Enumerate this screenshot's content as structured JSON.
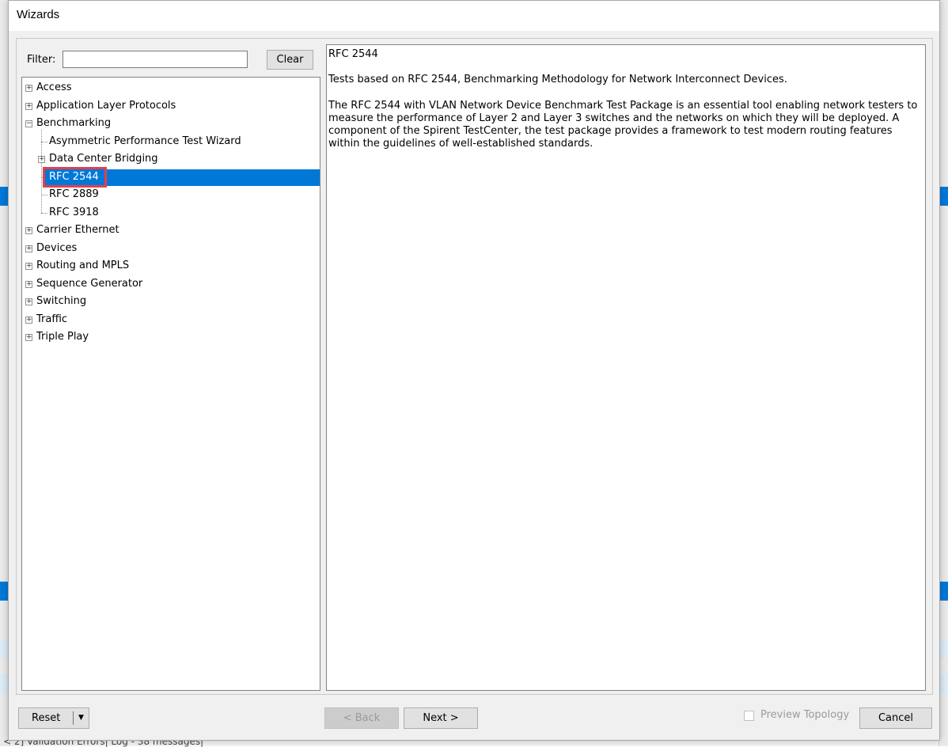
{
  "dialog": {
    "title": "Wizards"
  },
  "filter": {
    "label": "Filter:",
    "value": "",
    "clear_label": "Clear"
  },
  "tree": {
    "items": [
      {
        "label": "Access"
      },
      {
        "label": "Application Layer Protocols"
      },
      {
        "label": "Benchmarking"
      },
      {
        "label": "Asymmetric Performance Test Wizard"
      },
      {
        "label": "Data Center Bridging"
      },
      {
        "label": "RFC 2544"
      },
      {
        "label": "RFC 2889"
      },
      {
        "label": "RFC 3918"
      },
      {
        "label": "Carrier Ethernet"
      },
      {
        "label": "Devices"
      },
      {
        "label": "Routing and MPLS"
      },
      {
        "label": "Sequence Generator"
      },
      {
        "label": "Switching"
      },
      {
        "label": "Traffic"
      },
      {
        "label": "Triple Play"
      }
    ],
    "selected": "RFC 2544"
  },
  "description": {
    "title": "RFC 2544",
    "paragraph1": "Tests based on RFC 2544, Benchmarking Methodology for Network Interconnect Devices.",
    "paragraph2": "The RFC 2544 with VLAN Network Device Benchmark Test Package is an essential tool enabling network testers to measure the performance of Layer 2 and Layer 3 switches and the networks on which they will be deployed. A component of the Spirent TestCenter, the test package provides a framework to test modern routing features within the guidelines of well-established standards."
  },
  "buttons": {
    "reset": "Reset",
    "back": "< Back",
    "next": "Next >",
    "cancel": "Cancel",
    "preview_topology": "Preview Topology"
  },
  "background": {
    "status_text": "< 2]  Validation Errors|  Log - 38 messages|"
  },
  "colors": {
    "selection": "#0078d7",
    "highlight_box": "#e3404d"
  }
}
